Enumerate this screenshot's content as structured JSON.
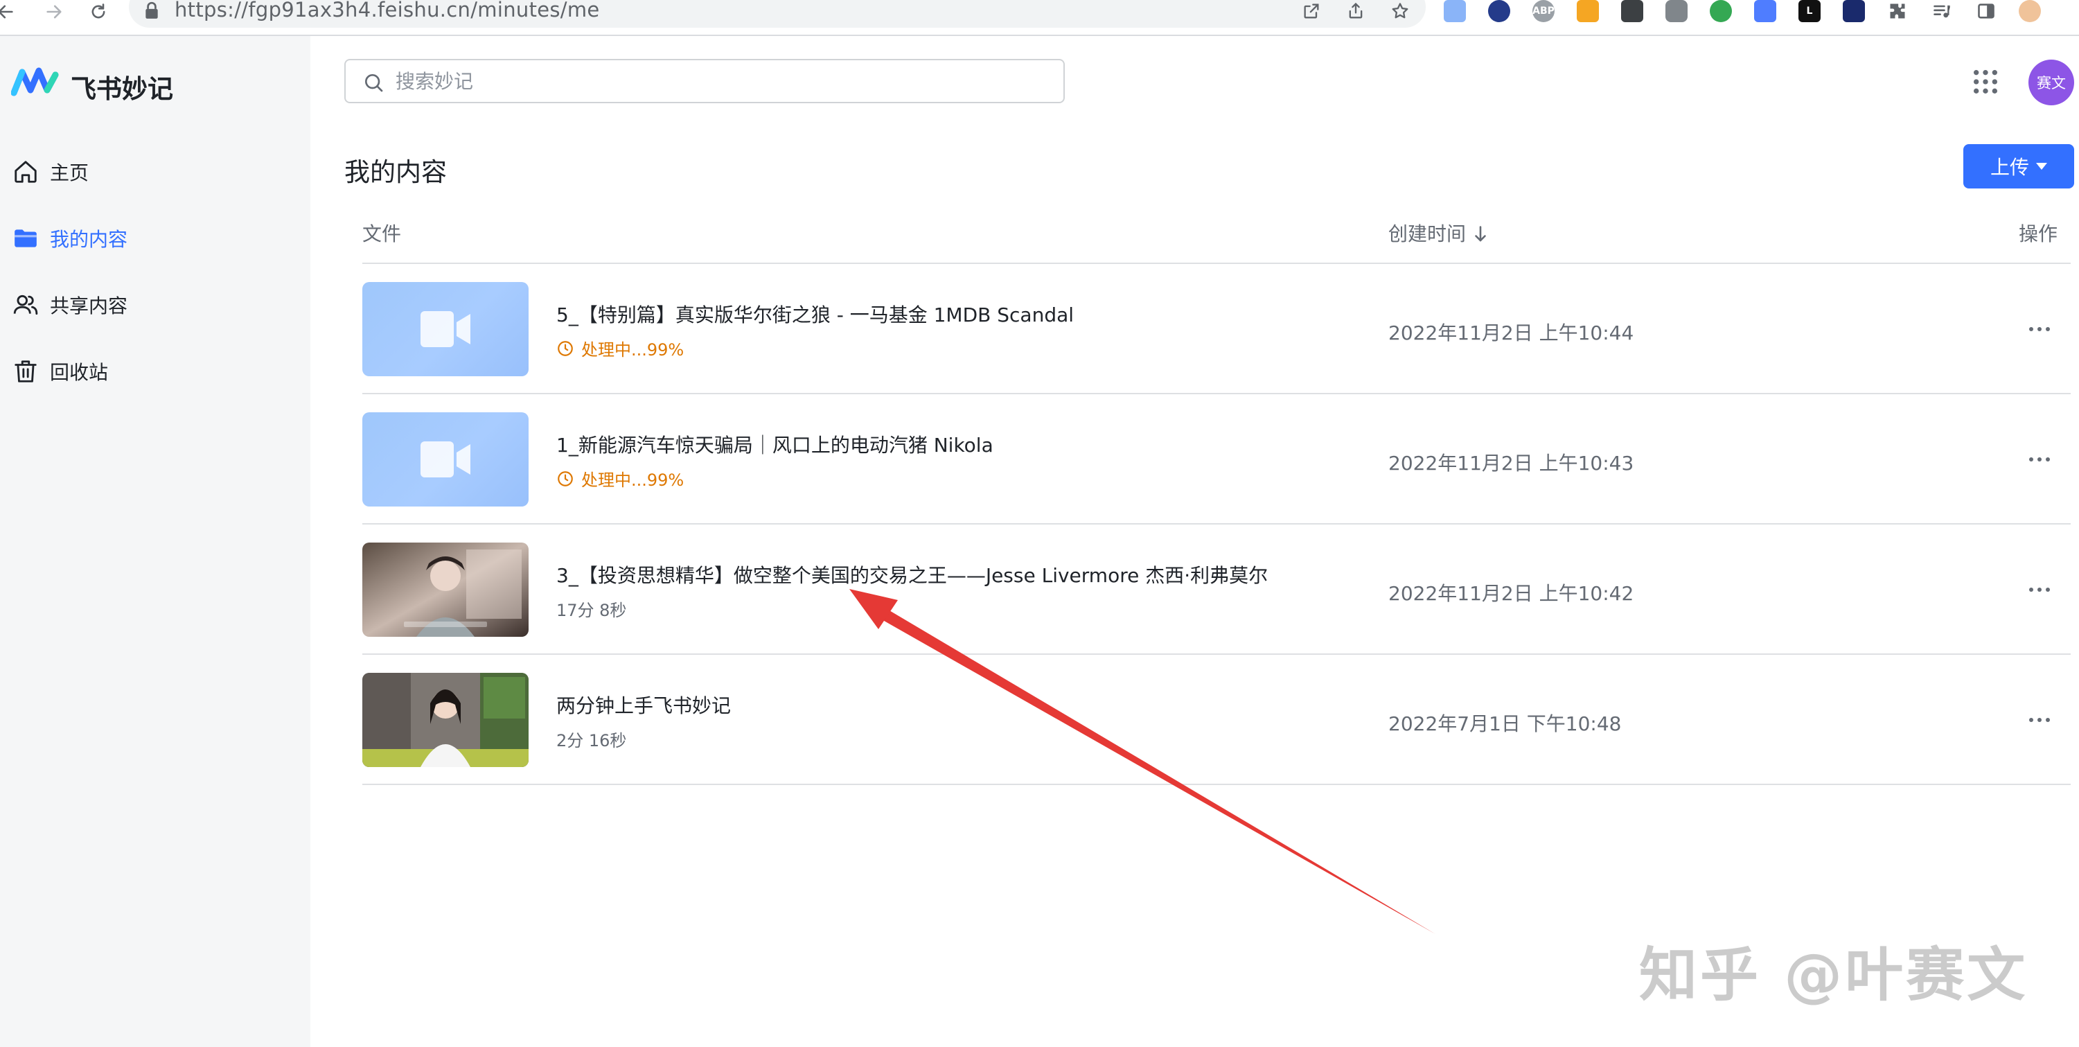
{
  "browser": {
    "url": "https://fgp91ax3h4.feishu.cn/minutes/me",
    "extensions": [
      "image-ext",
      "moon-ext",
      "ABP",
      "alarm-ext",
      "video-ext",
      "camera-ext",
      "globe-ext",
      "edit-ext",
      "L",
      "hex-ext"
    ]
  },
  "sidebar": {
    "brand": "飞书妙记",
    "items": [
      {
        "label": "主页",
        "icon": "home-icon",
        "active": false
      },
      {
        "label": "我的内容",
        "icon": "folder-icon",
        "active": true
      },
      {
        "label": "共享内容",
        "icon": "people-icon",
        "active": false
      },
      {
        "label": "回收站",
        "icon": "trash-icon",
        "active": false
      }
    ]
  },
  "header": {
    "search_placeholder": "搜索妙记",
    "avatar_text": "赛文"
  },
  "main": {
    "title": "我的内容",
    "upload_label": "上传",
    "columns": {
      "file": "文件",
      "created": "创建时间",
      "actions": "操作"
    },
    "rows": [
      {
        "title": "5_【特别篇】真实版华尔街之狼 - 一马基金 1MDB Scandal",
        "status": "处理中...99%",
        "duration": "",
        "time": "2022年11月2日 上午10:44",
        "thumb": "placeholder"
      },
      {
        "title": "1_新能源汽车惊天骗局｜风口上的电动汽猪 Nikola",
        "status": "处理中...99%",
        "duration": "",
        "time": "2022年11月2日 上午10:43",
        "thumb": "placeholder"
      },
      {
        "title": "3_【投资思想精华】做空整个美国的交易之王——Jesse Livermore 杰西·利弗莫尔",
        "status": "",
        "duration": "17分 8秒",
        "time": "2022年11月2日 上午10:42",
        "thumb": "video-frame"
      },
      {
        "title": "两分钟上手飞书妙记",
        "status": "",
        "duration": "2分 16秒",
        "time": "2022年7月1日 下午10:48",
        "thumb": "video-frame"
      }
    ]
  },
  "watermark": "知乎 @叶赛文",
  "colors": {
    "accent": "#3370ff",
    "processing": "#de7802",
    "avatar": "#8d55e6",
    "arrow": "#e53935"
  }
}
